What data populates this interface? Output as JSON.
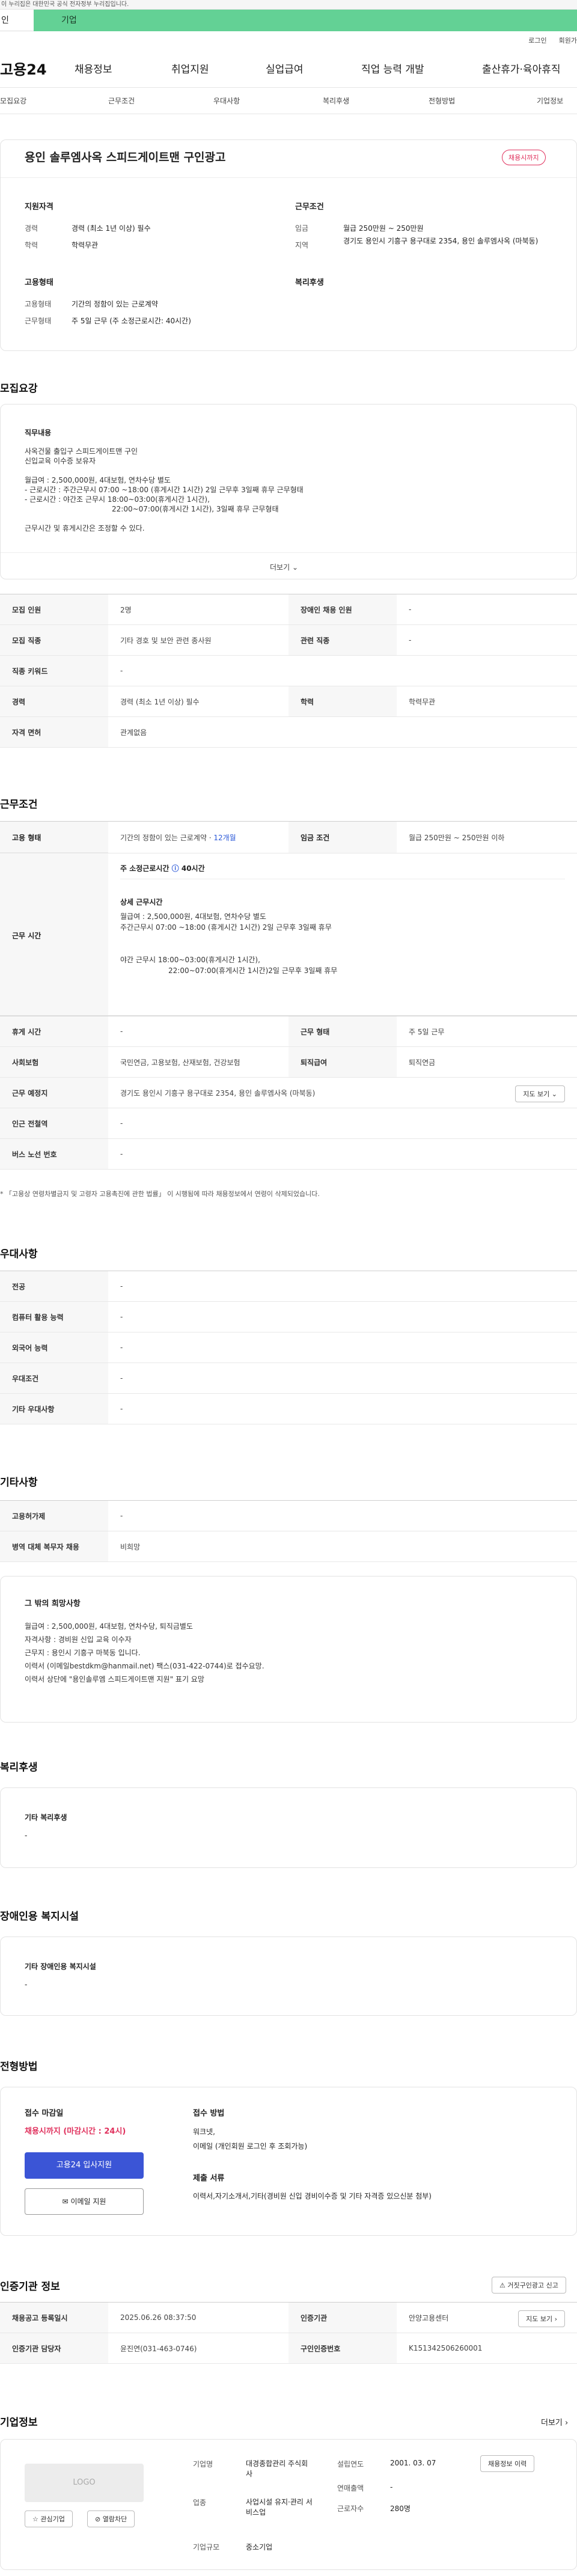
{
  "gov_banner": {
    "text": "이 누리집은 대한민국 공식 전자정부 누리집입니다.",
    "left_label": "인",
    "right_label": "기업"
  },
  "util": {
    "login": "로그인",
    "signup": "회원가"
  },
  "logo": "고용24",
  "gnb": [
    "채용정보",
    "취업지원",
    "실업급여",
    "직업 능력 개발",
    "출산휴가·육아휴직"
  ],
  "snb": [
    "모집요강",
    "근무조건",
    "우대사항",
    "복리후생",
    "전형방법",
    "기업정보"
  ],
  "header": {
    "title": "용인 솔루엠사옥 스피드게이트맨 구인광고",
    "badge": "채용시까지",
    "req_title": "지원자격",
    "career_label": "경력",
    "career_value": "경력 (최소 1년 이상) 필수",
    "edu_label": "학력",
    "edu_value": "학력무관",
    "emp_title": "고용형태",
    "emp_type_label": "고용형태",
    "emp_type_value": "기간의 정함이 있는 근로계약",
    "work_label": "근무형태",
    "work_value": "주 5일 근무 (주 소정근로시간: 40시간)",
    "cond_title": "근무조건",
    "wage_label": "임금",
    "wage_value": "월급 250만원 ~ 250만원",
    "region_label": "지역",
    "region_value": "경기도 용인시 기흥구 용구대로 2354, 용인 솔루엠사옥 (마북동)",
    "welfare_title": "복리후생"
  },
  "recruit": {
    "title": "모집요강",
    "duty_title": "직무내용",
    "lines": [
      "사옥건물 출입구 스피드게이트맨 구인",
      "신입교육 이수증 보유자",
      "",
      "월급여 : 2,500,000원, 4대보험, 연차수당 별도",
      "- 근로시간 : 주간근무시 07:00 ~18:00 (휴게시간 1시간) 2일 근무후 3일째 휴무 근무형태",
      "- 근로시간 : 야간조 근무시 18:00~03:00(휴게시간 1시간),",
      "22:00~07:00(휴게시간 1시간), 3일째 휴무 근무형태",
      "",
      "근무시간 및 휴게시간은 조정할 수 있다."
    ],
    "more": "더보기",
    "rows": [
      {
        "k1": "모집 인원",
        "v1": "2명",
        "k2": "장애인 채용 인원",
        "v2": "-"
      },
      {
        "k1": "모집 직종",
        "v1": "기타 경호 및 보안 관련 종사원",
        "k2": "관련 직종",
        "v2": "-"
      },
      {
        "k1": "직종 키워드",
        "v1": "-"
      },
      {
        "k1": "경력",
        "v1": "경력 (최소 1년 이상) 필수",
        "k2": "학력",
        "v2": "학력무관"
      },
      {
        "k1": "자격 면허",
        "v1": "관계없음"
      }
    ]
  },
  "cond": {
    "title": "근무조건",
    "emp_label": "고용 형태",
    "emp_value": "기간의 정함이 있는 근로계약 · ",
    "emp_months": "12개월",
    "wage_label": "임금 조건",
    "wage_value": "월급 250만원 ~ 250만원 이하",
    "time_label": "근무 시간",
    "weekly": "주 소정근로시간",
    "weekly_hours": "40시간",
    "detail_title": "상세 근무시간",
    "detail_lines": [
      "월급여 : 2,500,000원, 4대보험, 연차수당 별도",
      " 주간근무시 07:00 ~18:00 (휴게시간 1시간) 2일 근무후 3일째 휴무",
      "",
      " 야간 근무시 18:00~03:00(휴게시간 1시간),",
      " 22:00~07:00(휴게시간 1시간)2일 근무후 3일째 휴무"
    ],
    "rest_label": "휴게 시간",
    "rest_value": "-",
    "form_label": "근무 형태",
    "form_value": "주 5일 근무",
    "ins_label": "사회보험",
    "ins_value": "국민연금, 고용보험, 산재보험, 건강보험",
    "ret_label": "퇴직급여",
    "ret_value": "퇴직연금",
    "place_label": "근무 예정지",
    "place_value": "경기도 용인시 기흥구 용구대로 2354, 용인 솔루엠사옥 (마북동)",
    "map_btn": "지도 보기",
    "sub_label": "인근 전철역",
    "sub_value": "-",
    "bus_label": "버스 노선 번호",
    "bus_value": "-",
    "note": "* 「고용상 연령차별금지 및 고령자 고용촉진에 관한 법률」 이 시행됨에 따라 채용정보에서 연령이 삭제되었습니다."
  },
  "pref": {
    "title": "우대사항",
    "rows": [
      {
        "k": "전공",
        "v": "-"
      },
      {
        "k": "컴퓨터 활용 능력",
        "v": "-"
      },
      {
        "k": "외국어 능력",
        "v": "-"
      },
      {
        "k": "우대조건",
        "v": "-"
      },
      {
        "k": "기타 우대사항",
        "v": "-"
      }
    ]
  },
  "etc": {
    "title": "기타사항",
    "rows": [
      {
        "k": "고용허가제",
        "v": "-"
      },
      {
        "k": "병역 대체 복무자 채용",
        "v": "비희망"
      }
    ],
    "other_title": "그 밖의 희망사항",
    "other_lines": [
      "월급여 : 2,500,000원, 4대보험, 연차수당, 퇴직금별도",
      "자격사항 : 경비원 신입 교육 이수자",
      "근무지 : 용인시 기흥구 마북동 입니다.",
      "이력서 (이메일bestdkm@hanmail.net) 팩스(031-422-0744)로 접수요망.",
      "이력서 상단에 \"용인솔루엠 스피드게이트맨 지원\" 표기 요망"
    ]
  },
  "welfare": {
    "title": "복리후생",
    "sub": "기타 복리후생",
    "value": "-"
  },
  "disab": {
    "title": "장애인용 복지시설",
    "sub": "기타 장애인용 복지시설",
    "value": "-"
  },
  "screen": {
    "title": "전형방법",
    "deadline_title": "접수 마감일",
    "deadline_value": "채용시까지 (마감시간 : 24시)",
    "apply_btn": "고용24 입사지원",
    "email_btn": "이메일 지원",
    "method_title": "접수 방법",
    "method_lines": [
      "워크넷,",
      "이메일 (개인회원 로그인 후 조회가능)"
    ],
    "docs_title": "제출 서류",
    "docs_value": "이력서,자기소개서,기타(경비원 신입 경비이수증 및 기타 자격증 있으신분 첨부)"
  },
  "agency": {
    "title": "인증기관 정보",
    "report_btn": "거짓구인광고 신고",
    "reg_label": "채용공고 등록일시",
    "reg_value": "2025.06.26 08:37:50",
    "org_label": "인증기관",
    "org_value": "안양고용센터",
    "map_btn": "지도 보기",
    "mgr_label": "인증기관 담당자",
    "mgr_value": "윤진연(031-463-0746)",
    "num_label": "구인인증번호",
    "num_value": "K151342506260001"
  },
  "company": {
    "title": "기업정보",
    "more": "더보기",
    "logo": "LOGO",
    "fav_btn": "관심기업",
    "block_btn": "열람차단",
    "name_label": "기업명",
    "name_value": "대경종합관리 주식회사",
    "year_label": "설립연도",
    "year_value": "2001. 03. 07",
    "recruit_btn": "채용정보 이력",
    "industry_label": "업종",
    "industry_value": "사업시설 유지·관리 서비스업",
    "sales_label": "연매출액",
    "sales_value": "-",
    "emp_label": "근로자수",
    "emp_value": "280명",
    "size_label": "기업규모",
    "size_value": "중소기업"
  },
  "colors": {
    "accent": "#3b55d6",
    "pink": "#e0315d",
    "green": "#63d195"
  },
  "icons": [
    "chevron-down-icon",
    "chevron-right-icon",
    "info-icon",
    "mail-icon",
    "star-icon",
    "block-icon",
    "siren-icon"
  ]
}
